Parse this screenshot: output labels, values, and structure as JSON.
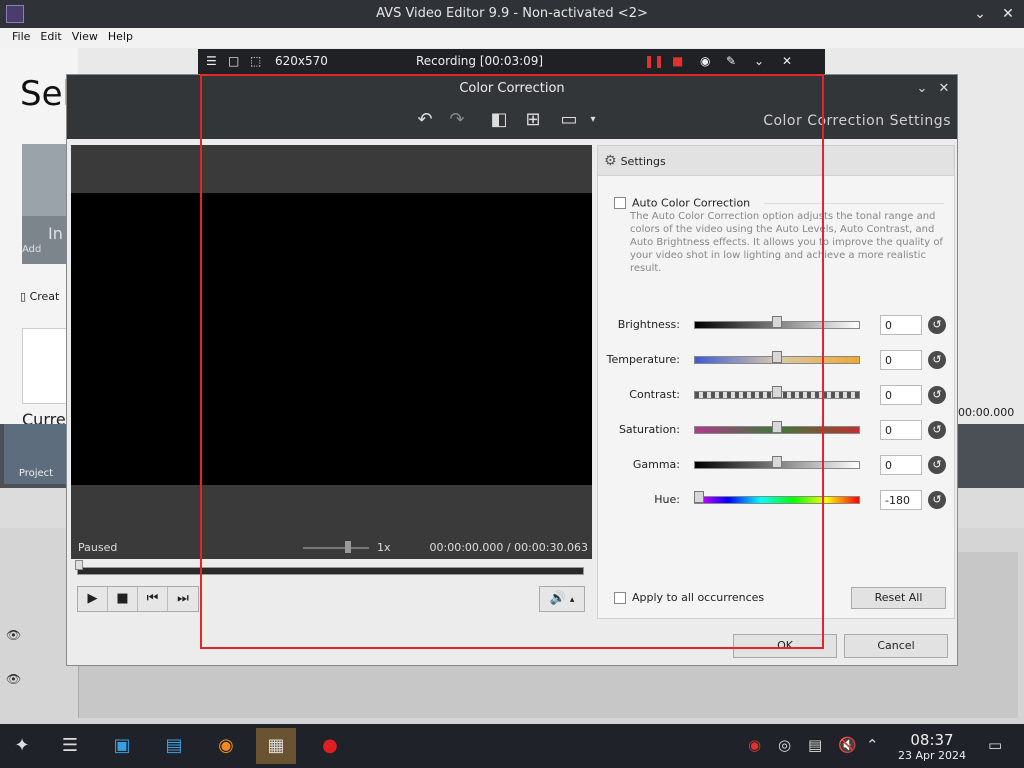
{
  "window": {
    "title": "AVS Video Editor 9.9 - Non-activated <2>",
    "min_label": "⌄",
    "close_label": "✕"
  },
  "menu": [
    "File",
    "Edit",
    "View",
    "Help"
  ],
  "background": {
    "heading_partial": "Sel",
    "tile_text": "In",
    "tile_subtext": "Add",
    "create_text": "Creat",
    "current_text": "Curren",
    "project_label": "Project",
    "right_time": "00:00.000"
  },
  "recorder": {
    "size": "620x570",
    "status": "Recording [00:03:09]"
  },
  "dialog": {
    "title": "Color Correction",
    "settings_title": "Color Correction Settings",
    "panel_header": "Settings",
    "auto": {
      "label": "Auto Color Correction",
      "description": "The Auto Color Correction option adjusts the tonal range and colors of the video using the Auto Levels, Auto Contrast, and Auto Brightness effects. It allows you to improve the quality of your video shot in low lighting and achieve a more realistic result."
    },
    "sliders": [
      {
        "label": "Brightness:",
        "value": "0",
        "level": 0.5
      },
      {
        "label": "Temperature:",
        "value": "0",
        "level": 0.5
      },
      {
        "label": "Contrast:",
        "value": "0",
        "level": 0.5
      },
      {
        "label": "Saturation:",
        "value": "0",
        "level": 0.5
      },
      {
        "label": "Gamma:",
        "value": "0",
        "level": 0.5
      },
      {
        "label": "Hue:",
        "value": "-180",
        "level": 0.0
      }
    ],
    "apply_label": "Apply to all occurrences",
    "reset_all": "Reset All",
    "ok": "OK",
    "cancel": "Cancel",
    "player": {
      "status": "Paused",
      "speed": "1x",
      "time": "00:00:00.000 /  00:00:30.063"
    }
  },
  "clock": {
    "time": "08:37",
    "date": "23 Apr 2024"
  }
}
